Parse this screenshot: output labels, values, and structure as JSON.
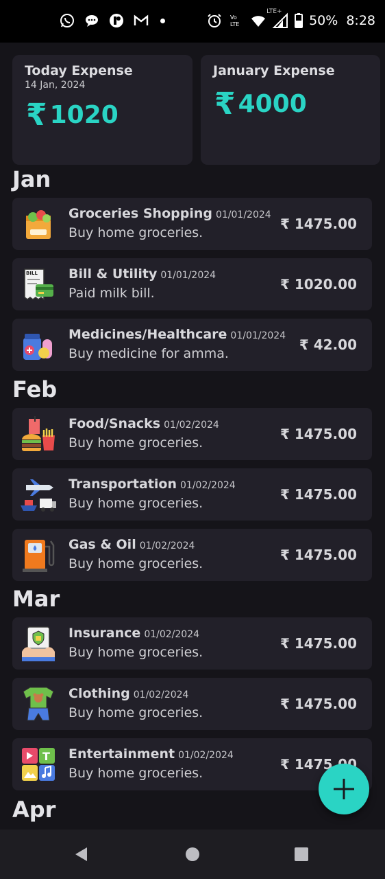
{
  "status_bar": {
    "battery": "50%",
    "time": "8:28",
    "left_icons": [
      "whatsapp-icon",
      "messenger-icon",
      "notification-icon",
      "gmail-icon"
    ],
    "right_icons": [
      "alarm-icon",
      "volte-icon",
      "wifi-icon",
      "signal-icon",
      "battery-icon"
    ],
    "network_label": "LTE+"
  },
  "summary": {
    "today": {
      "title": "Today Expense",
      "date": "14 Jan, 2024",
      "currency": "₹",
      "amount": "1020"
    },
    "month": {
      "title": "January Expense",
      "currency": "₹",
      "amount": "4000"
    }
  },
  "accent_color": "#2ad4c4",
  "sections": [
    {
      "month": "Jan",
      "items": [
        {
          "category": "Groceries Shopping",
          "date": "01/01/2024",
          "description": "Buy home groceries.",
          "amount": "₹ 1475.00",
          "icon": "groceries-icon"
        },
        {
          "category": "Bill & Utility",
          "date": "01/01/2024",
          "description": "Paid milk bill.",
          "amount": "₹ 1020.00",
          "icon": "bill-icon"
        },
        {
          "category": "Medicines/Healthcare",
          "date": "01/01/2024",
          "description": "Buy medicine for amma.",
          "amount": "₹ 42.00",
          "icon": "medicine-icon"
        }
      ]
    },
    {
      "month": "Feb",
      "items": [
        {
          "category": "Food/Snacks",
          "date": "01/02/2024",
          "description": "Buy home groceries.",
          "amount": "₹ 1475.00",
          "icon": "food-icon"
        },
        {
          "category": "Transportation",
          "date": "01/02/2024",
          "description": "Buy home groceries.",
          "amount": "₹ 1475.00",
          "icon": "transport-icon"
        },
        {
          "category": "Gas & Oil",
          "date": "01/02/2024",
          "description": "Buy home groceries.",
          "amount": "₹ 1475.00",
          "icon": "fuel-pump-icon"
        }
      ]
    },
    {
      "month": "Mar",
      "items": [
        {
          "category": "Insurance",
          "date": "01/02/2024",
          "description": "Buy home groceries.",
          "amount": "₹ 1475.00",
          "icon": "insurance-icon"
        },
        {
          "category": "Clothing",
          "date": "01/02/2024",
          "description": "Buy home groceries.",
          "amount": "₹ 1475.00",
          "icon": "clothing-icon"
        },
        {
          "category": "Entertainment",
          "date": "01/02/2024",
          "description": "Buy home groceries.",
          "amount": "₹ 1475.00",
          "icon": "entertainment-icon"
        }
      ]
    },
    {
      "month": "Apr",
      "items": []
    }
  ],
  "fab": {
    "icon": "plus-icon"
  },
  "nav_bar": [
    "back-icon",
    "home-icon",
    "recents-icon"
  ]
}
